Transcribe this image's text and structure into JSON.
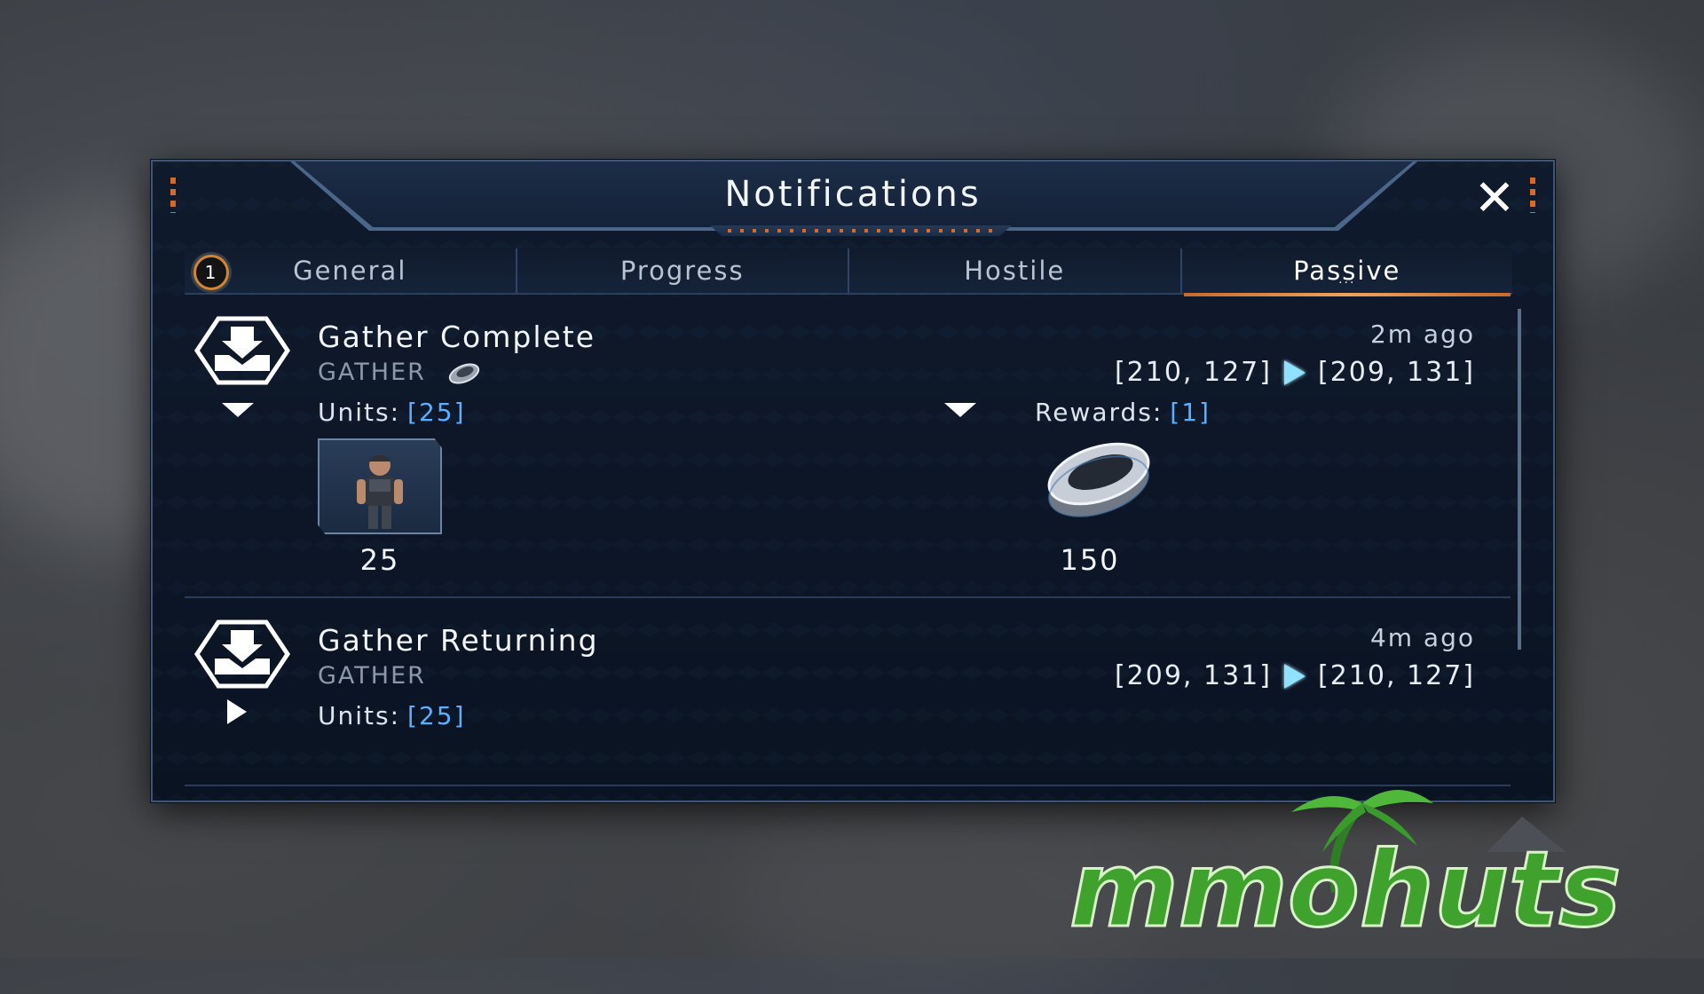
{
  "window": {
    "title": "Notifications",
    "close_icon": "close-icon",
    "accent_color": "#d56a2a"
  },
  "tabs": [
    {
      "label": "General",
      "badge": "1"
    },
    {
      "label": "Progress"
    },
    {
      "label": "Hostile"
    },
    {
      "label": "Passive",
      "active": true,
      "active_marker": "···"
    }
  ],
  "notifications": [
    {
      "icon": "gather-download-icon",
      "title": "Gather Complete",
      "type": "GATHER",
      "type_icon": "metal-ring-icon",
      "time": "2m ago",
      "from": "[210, 127]",
      "to": "[209, 131]",
      "units_label": "Units:",
      "units_value": "[25]",
      "rewards_label": "Rewards:",
      "rewards_value": "[1]",
      "unit_card_icon": "soldier-portrait",
      "unit_count": "25",
      "reward_icon": "metal-ring-icon",
      "reward_count": "150",
      "expanded": true
    },
    {
      "icon": "gather-download-icon",
      "title": "Gather Returning",
      "type": "GATHER",
      "time": "4m ago",
      "from": "[209, 131]",
      "to": "[210, 127]",
      "units_label": "Units:",
      "units_value": "[25]",
      "expanded": false
    }
  ],
  "watermark": {
    "text": "mmohuts",
    "colors": {
      "primary": "#3fa22d",
      "secondary": "#9aa0a6"
    }
  }
}
